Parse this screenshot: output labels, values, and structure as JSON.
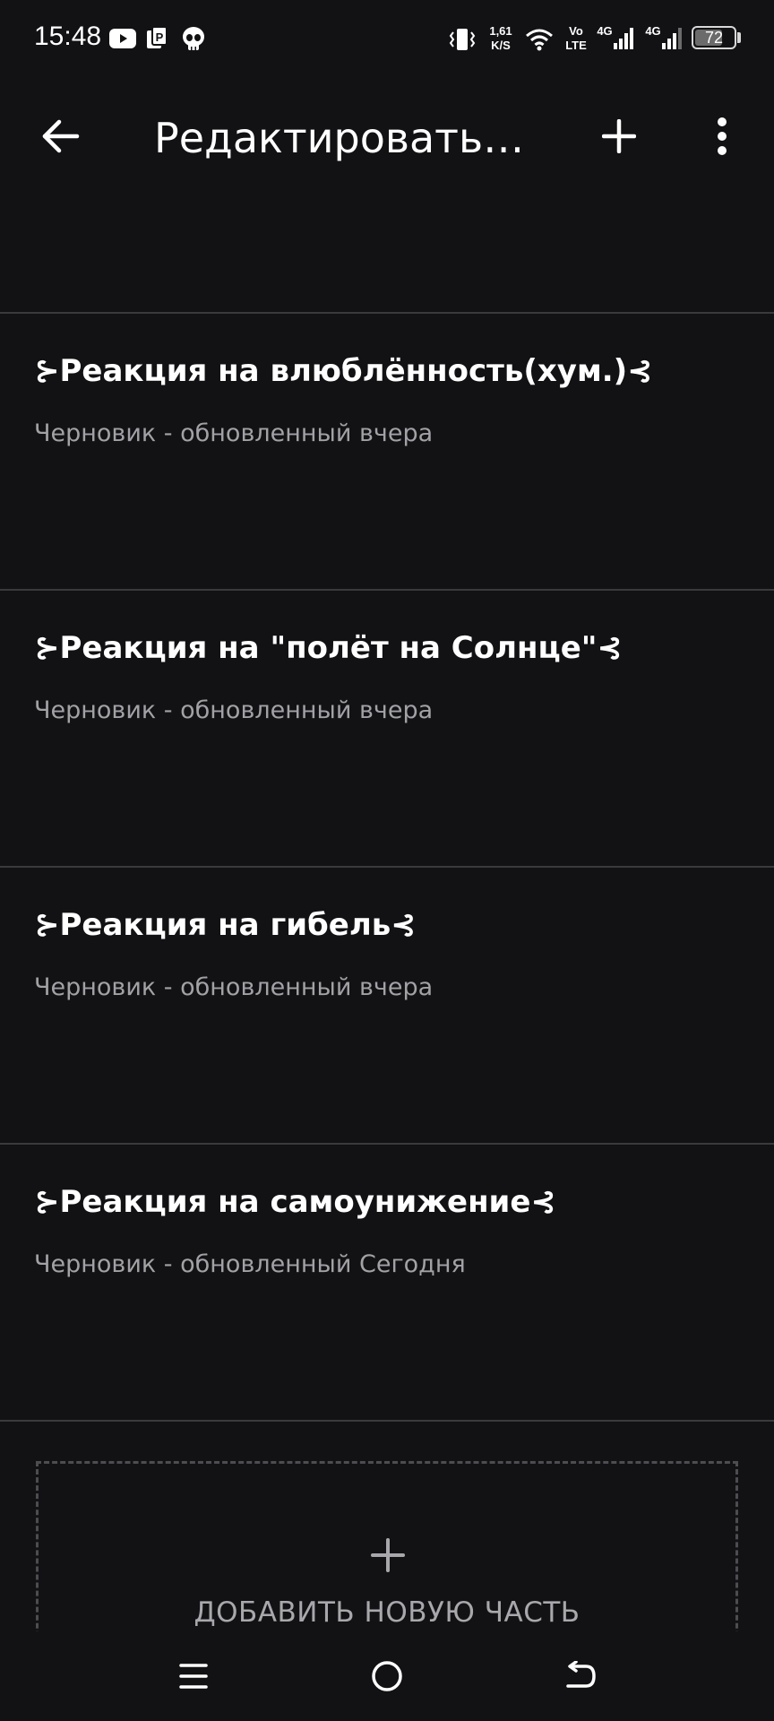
{
  "status_bar": {
    "time": "15:48",
    "speed_value": "1,61",
    "speed_unit": "K/S",
    "volte_top": "Vo",
    "volte_bottom": "LTE",
    "net1": "4G",
    "net2": "4G",
    "battery_level": "72",
    "battery_fraction": 0.72,
    "icons": [
      "youtube-icon",
      "notification-app-icon",
      "alien-skull-icon",
      "vibrate-icon",
      "wifi-icon",
      "signal-icon",
      "signal-icon"
    ]
  },
  "app_bar": {
    "title": "Редактировать и...",
    "icons": [
      "back-arrow-icon",
      "plus-icon",
      "more-vert-icon"
    ]
  },
  "parts": [
    {
      "title": "⊱Реакция на влюблённость(хум.)⊰",
      "status": "Черновик - обновленный вчера"
    },
    {
      "title": "⊱Реакция на \"полёт на Солнце\"⊰",
      "status": "Черновик - обновленный вчера"
    },
    {
      "title": "⊱Реакция на гибель⊰",
      "status": "Черновик - обновленный вчера"
    },
    {
      "title": "⊱Реакция на самоунижение⊰",
      "status": "Черновик - обновленный Сегодня"
    }
  ],
  "add_part": {
    "label": "ДОБАВИТЬ НОВУЮ ЧАСТЬ",
    "icon": "plus-icon"
  },
  "nav_bar": {
    "icons": [
      "menu-icon",
      "home-circle-icon",
      "back-nav-icon"
    ]
  },
  "colors": {
    "background": "#121114",
    "divider": "#3a393d",
    "secondary_text": "#a2a2a6",
    "dashed_border": "#4d4c51"
  }
}
